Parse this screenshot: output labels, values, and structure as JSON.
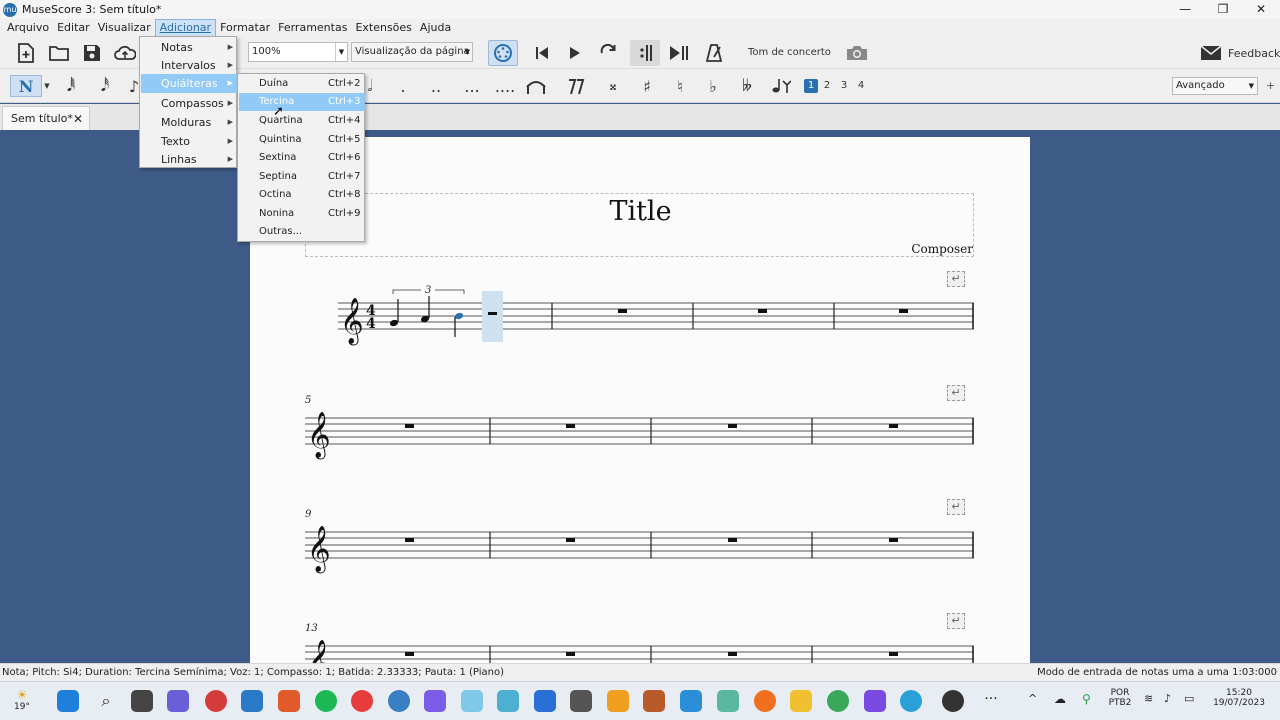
{
  "window": {
    "title": "MuseScore 3: Sem título*",
    "logo": "mu",
    "controls": [
      "—",
      "❐",
      "✕"
    ]
  },
  "menubar": [
    "Arquivo",
    "Editar",
    "Visualizar",
    "Adicionar",
    "Formatar",
    "Ferramentas",
    "Extensões",
    "Ajuda"
  ],
  "toolbar1": {
    "zoom": "100%",
    "view_mode": "Visualização da página",
    "concert_pitch": "Tom de concerto",
    "feedback": "Feedback"
  },
  "toolbar2": {
    "note_input": "N",
    "voices": [
      "1",
      "2",
      "3",
      "4"
    ],
    "workspace": "Avançado",
    "add": "+"
  },
  "tab": {
    "label": "Sem título*",
    "close": "✕"
  },
  "score": {
    "title": "Title",
    "composer": "Composer",
    "tuplet_number": "3",
    "time_signature": "4",
    "measure_numbers": [
      "5",
      "9",
      "13"
    ]
  },
  "menu_adicionar": [
    {
      "label": "Notas",
      "arrow": "▶"
    },
    {
      "label": "Intervalos",
      "arrow": "▶"
    },
    {
      "label": "Quiálteras",
      "arrow": "▶"
    },
    {
      "label": "Compassos",
      "arrow": "▶"
    },
    {
      "label": "Molduras",
      "arrow": "▶"
    },
    {
      "label": "Texto",
      "arrow": "▶"
    },
    {
      "label": "Linhas",
      "arrow": "▶"
    }
  ],
  "menu_quialteras": [
    {
      "label": "Duína",
      "shortcut": "Ctrl+2"
    },
    {
      "label": "Tercina",
      "shortcut": "Ctrl+3"
    },
    {
      "label": "Quartina",
      "shortcut": "Ctrl+4"
    },
    {
      "label": "Quintina",
      "shortcut": "Ctrl+5"
    },
    {
      "label": "Sextina",
      "shortcut": "Ctrl+6"
    },
    {
      "label": "Septina",
      "shortcut": "Ctrl+7"
    },
    {
      "label": "Octina",
      "shortcut": "Ctrl+8"
    },
    {
      "label": "Nonina",
      "shortcut": "Ctrl+9"
    },
    {
      "label": "Outras...",
      "shortcut": ""
    }
  ],
  "statusbar": {
    "left": "Nota; Pitch: Si4; Duration: Tercina Semínima; Voz: 1;  Compasso: 1; Batida: 2.33333; Pauta: 1 (Piano)",
    "right": "Modo de entrada de notas uma a uma    1:03:000"
  },
  "taskbar": {
    "weather": "19°",
    "lang1": "POR",
    "lang2": "PTB2",
    "time": "15:20",
    "date": "19/07/2023"
  },
  "colors": {
    "accent": "#2a6fb0",
    "menu_highlight": "#91c9f7",
    "score_bg": "#3e5a86"
  }
}
